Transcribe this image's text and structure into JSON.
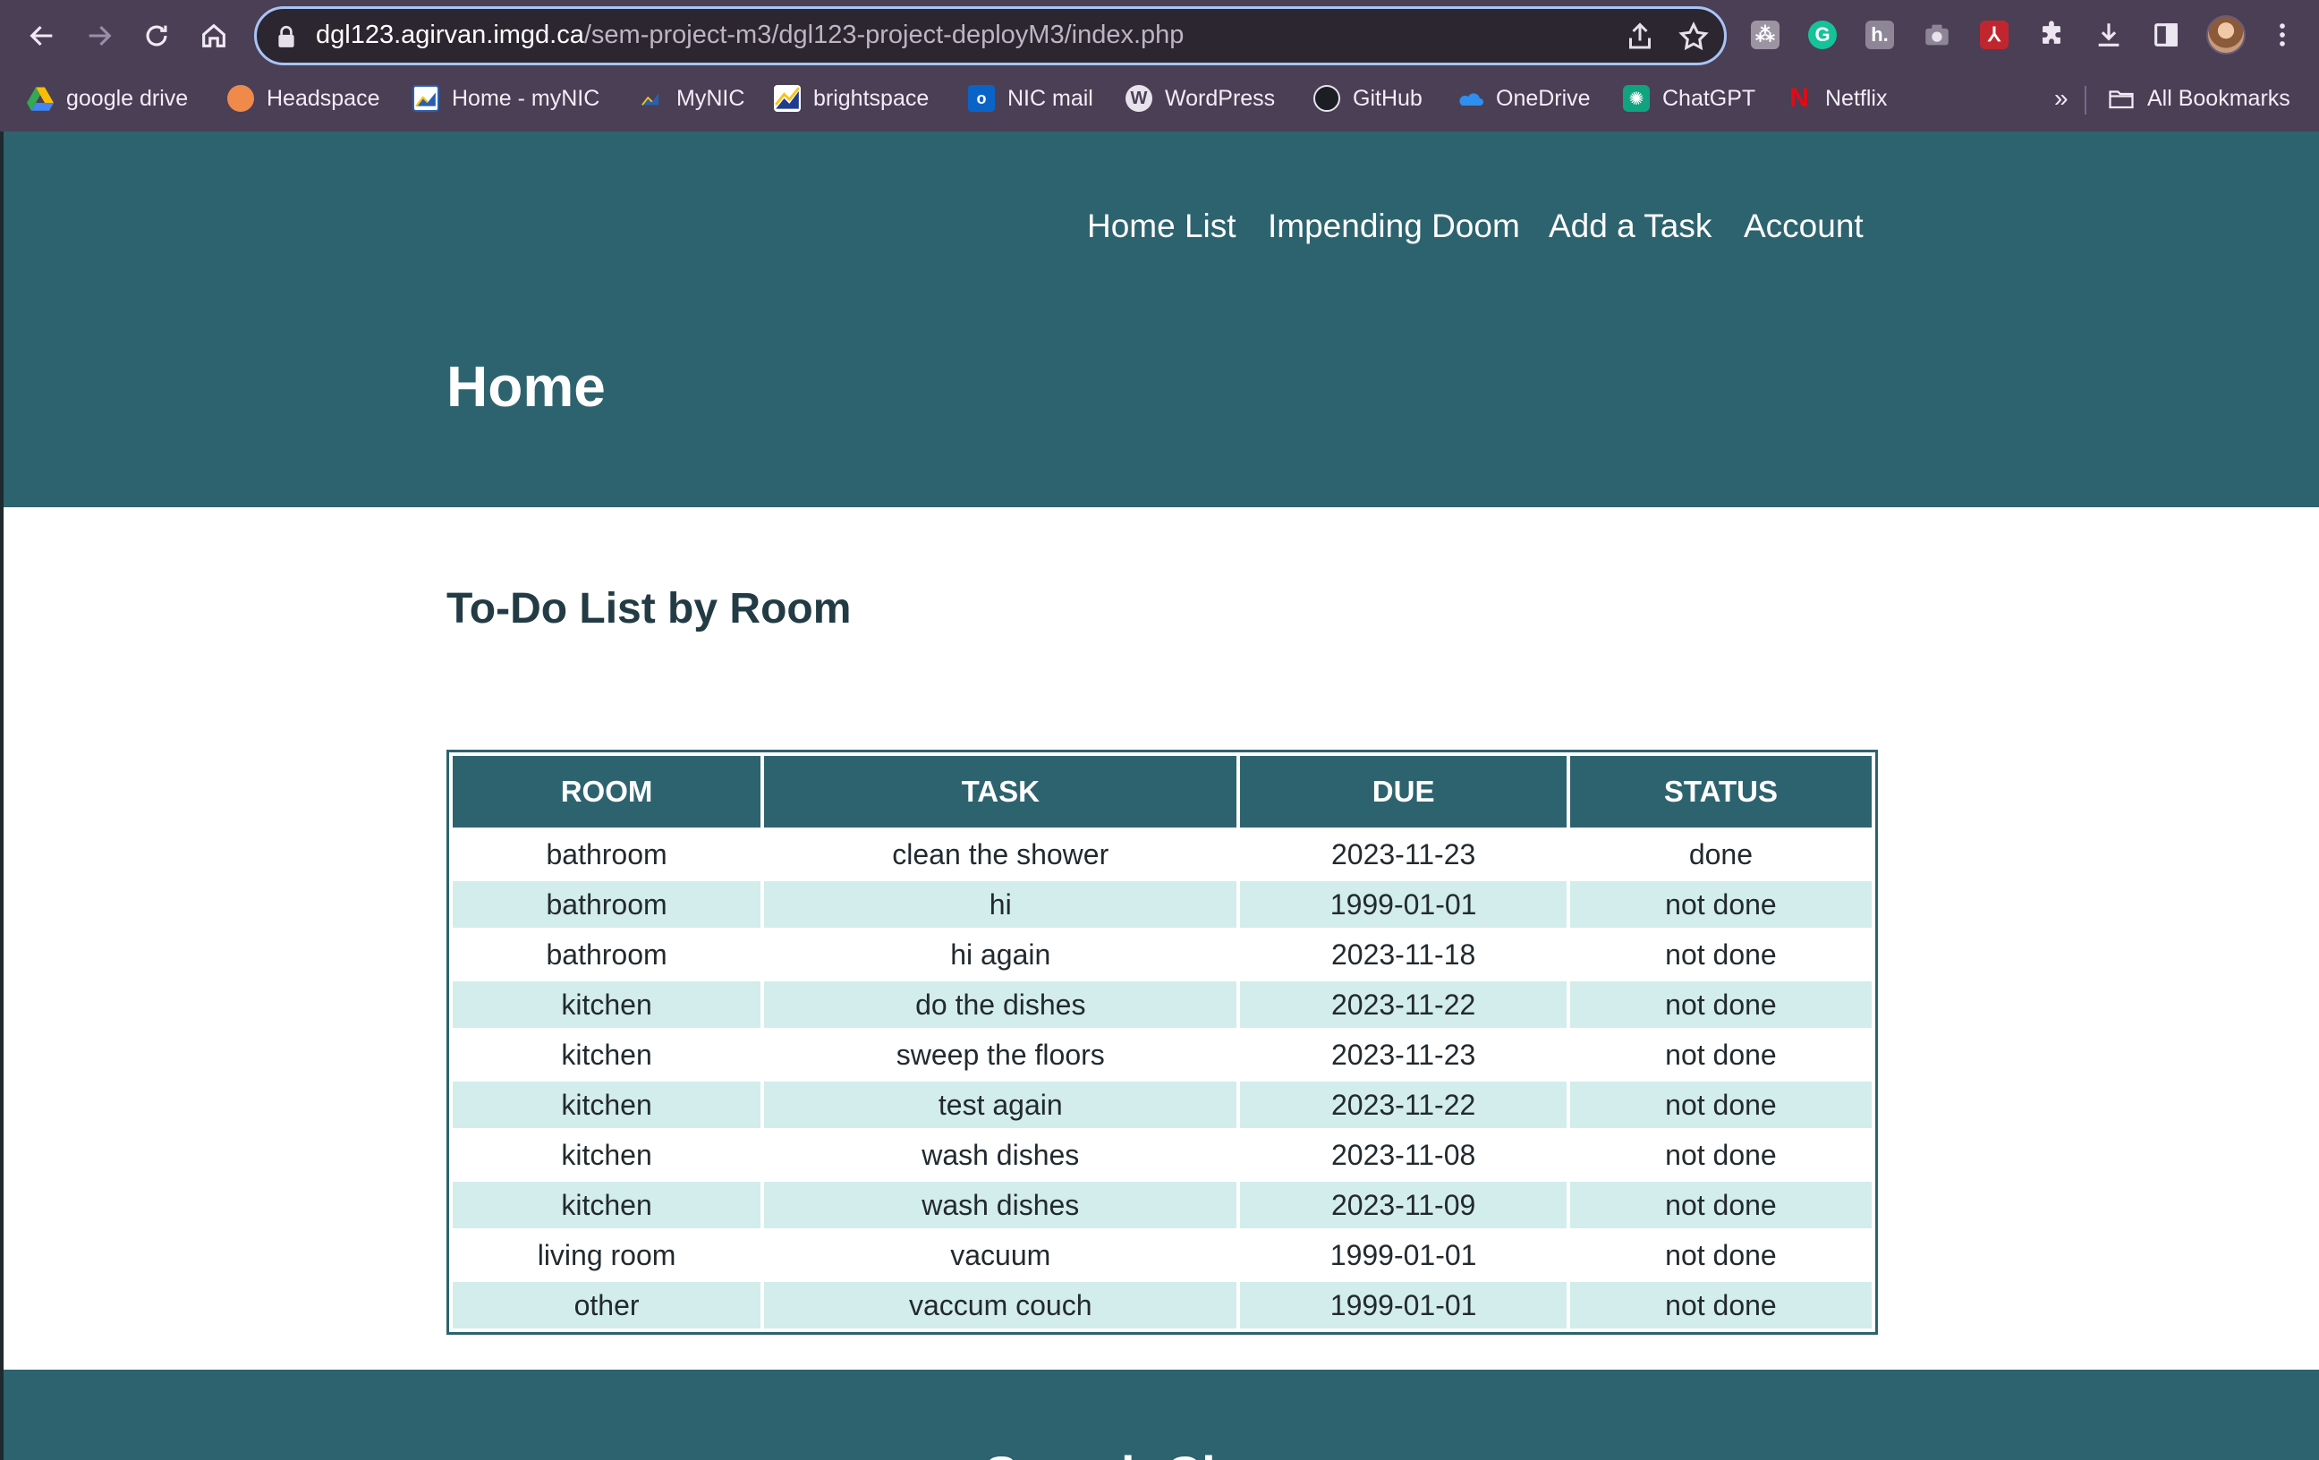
{
  "browser": {
    "url_host": "dgl123.agirvan.imgd.ca",
    "url_path": "/sem-project-m3/dgl123-project-deployM3/index.php",
    "bookmarks": [
      {
        "label": "google drive",
        "icon": "google-drive-icon"
      },
      {
        "label": "Headspace",
        "icon": "headspace-icon"
      },
      {
        "label": "Home - myNIC",
        "icon": "mynic-icon"
      },
      {
        "label": "MyNIC",
        "icon": "mynic-small-icon"
      },
      {
        "label": "brightspace",
        "icon": "brightspace-icon"
      },
      {
        "label": "NIC mail",
        "icon": "outlook-icon"
      },
      {
        "label": "WordPress",
        "icon": "wordpress-icon"
      },
      {
        "label": "GitHub",
        "icon": "github-icon"
      },
      {
        "label": "OneDrive",
        "icon": "onedrive-icon"
      },
      {
        "label": "ChatGPT",
        "icon": "chatgpt-icon"
      },
      {
        "label": "Netflix",
        "icon": "netflix-icon"
      }
    ],
    "overflow_label": "»",
    "all_bookmarks_label": "All Bookmarks"
  },
  "site": {
    "nav": [
      "Home List",
      "Impending Doom",
      "Add a Task",
      "Account"
    ],
    "page_title": "Home",
    "section_title": "To-Do List by Room",
    "table": {
      "headers": [
        "ROOM",
        "TASK",
        "DUE",
        "STATUS"
      ],
      "rows": [
        [
          "bathroom",
          "clean the shower",
          "2023-11-23",
          "done"
        ],
        [
          "bathroom",
          "hi",
          "1999-01-01",
          "not done"
        ],
        [
          "bathroom",
          "hi again",
          "2023-11-18",
          "not done"
        ],
        [
          "kitchen",
          "do the dishes",
          "2023-11-22",
          "not done"
        ],
        [
          "kitchen",
          "sweep the floors",
          "2023-11-23",
          "not done"
        ],
        [
          "kitchen",
          "test again",
          "2023-11-22",
          "not done"
        ],
        [
          "kitchen",
          "wash dishes",
          "2023-11-08",
          "not done"
        ],
        [
          "kitchen",
          "wash dishes",
          "2023-11-09",
          "not done"
        ],
        [
          "living room",
          "vacuum",
          "1999-01-01",
          "not done"
        ],
        [
          "other",
          "vaccum couch",
          "1999-01-01",
          "not done"
        ]
      ]
    },
    "footer_title": "Search Chores"
  },
  "colors": {
    "brand": "#2d636f",
    "row_alt": "#d3ecec",
    "chrome": "#4a3f55"
  }
}
